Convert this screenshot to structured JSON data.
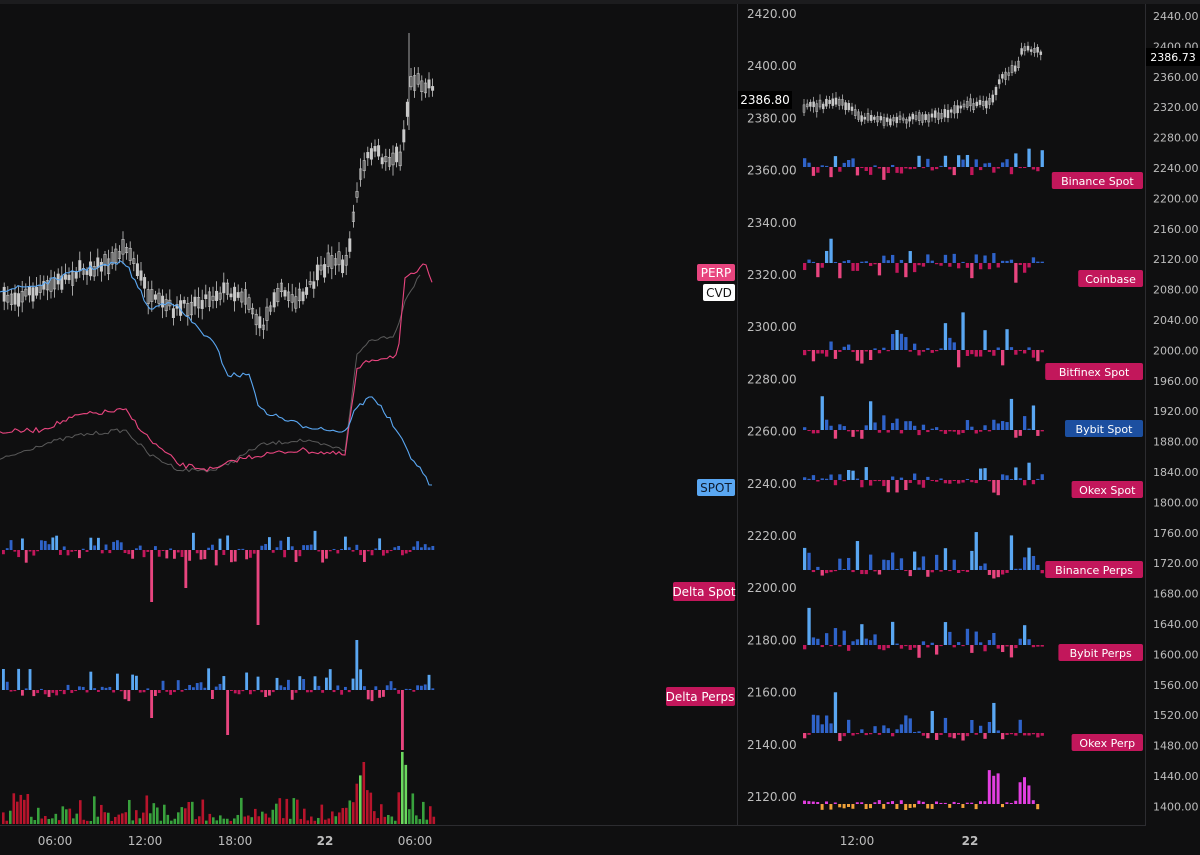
{
  "colors": {
    "background": "#0f0f10",
    "candle": "#c9c9c9",
    "buy": "#2f63c9",
    "buy_bright": "#5aa7f2",
    "sell": "#c2175b",
    "sell_bright": "#e8457f",
    "vol_buy": "#38a13d",
    "vol_buy_bright": "#6bd95f",
    "vol_sell": "#b8142c",
    "label_sell": "#c2175b",
    "label_buy": "#1c4fa0",
    "magenta": "#e23ee0",
    "orange": "#f0a23a",
    "axis_text": "#bdbdbd"
  },
  "left_chart": {
    "labels": {
      "perp": "PERP",
      "cvd": "CVD",
      "spot": "SPOT",
      "delta_spot": "Delta Spot",
      "delta_perps": "Delta Perps"
    },
    "x_ticks": [
      "06:00",
      "12:00",
      "18:00",
      "22",
      "06:00"
    ],
    "x_ticks_bold": [
      false,
      false,
      false,
      true,
      false
    ]
  },
  "middle_axis": {
    "ticks": [
      "2420.00",
      "2400.00",
      "2380.00",
      "2360.00",
      "2340.00",
      "2320.00",
      "2300.00",
      "2280.00",
      "2260.00",
      "2240.00",
      "2220.00",
      "2200.00",
      "2180.00",
      "2160.00",
      "2140.00",
      "2120.00"
    ],
    "current_price": "2386.80"
  },
  "right_chart": {
    "axis_ticks": [
      "2440.00",
      "2400.00",
      "2360.00",
      "2320.00",
      "2280.00",
      "2240.00",
      "2200.00",
      "2160.00",
      "2120.00",
      "2080.00",
      "2040.00",
      "2000.00",
      "1960.00",
      "1920.00",
      "1880.00",
      "1840.00",
      "1800.00",
      "1760.00",
      "1720.00",
      "1680.00",
      "1640.00",
      "1600.00",
      "1560.00",
      "1520.00",
      "1480.00",
      "1440.00",
      "1400.00"
    ],
    "current_price": "2386.73",
    "x_ticks": [
      "12:00",
      "22"
    ],
    "x_ticks_bold": [
      false,
      true
    ],
    "panels": [
      {
        "name": "Binance Spot",
        "color": "sell"
      },
      {
        "name": "Coinbase",
        "color": "sell"
      },
      {
        "name": "Bitfinex Spot",
        "color": "sell"
      },
      {
        "name": "Bybit Spot",
        "color": "buy"
      },
      {
        "name": "Okex Spot",
        "color": "sell"
      },
      {
        "name": "Binance Perps",
        "color": "sell"
      },
      {
        "name": "Bybit Perps",
        "color": "sell"
      },
      {
        "name": "Okex Perp",
        "color": "sell"
      }
    ]
  },
  "chart_data": [
    {
      "type": "line",
      "title": "",
      "series": [
        {
          "name": "PERP"
        },
        {
          "name": "CVD"
        },
        {
          "name": "SPOT"
        }
      ],
      "x": [
        "06:00",
        "12:00",
        "18:00",
        "22",
        "06:00"
      ],
      "ylim": [
        2120,
        2420
      ]
    },
    {
      "type": "bar",
      "series": [
        {
          "name": "Delta Spot"
        },
        {
          "name": "Delta Perps"
        }
      ]
    },
    {
      "type": "bar",
      "series": [
        {
          "name": "Binance Spot"
        },
        {
          "name": "Coinbase"
        },
        {
          "name": "Bitfinex Spot"
        },
        {
          "name": "Bybit Spot"
        },
        {
          "name": "Okex Spot"
        },
        {
          "name": "Binance Perps"
        },
        {
          "name": "Bybit Perps"
        },
        {
          "name": "Okex Perp"
        }
      ],
      "ylim": [
        1400,
        2440
      ]
    }
  ]
}
